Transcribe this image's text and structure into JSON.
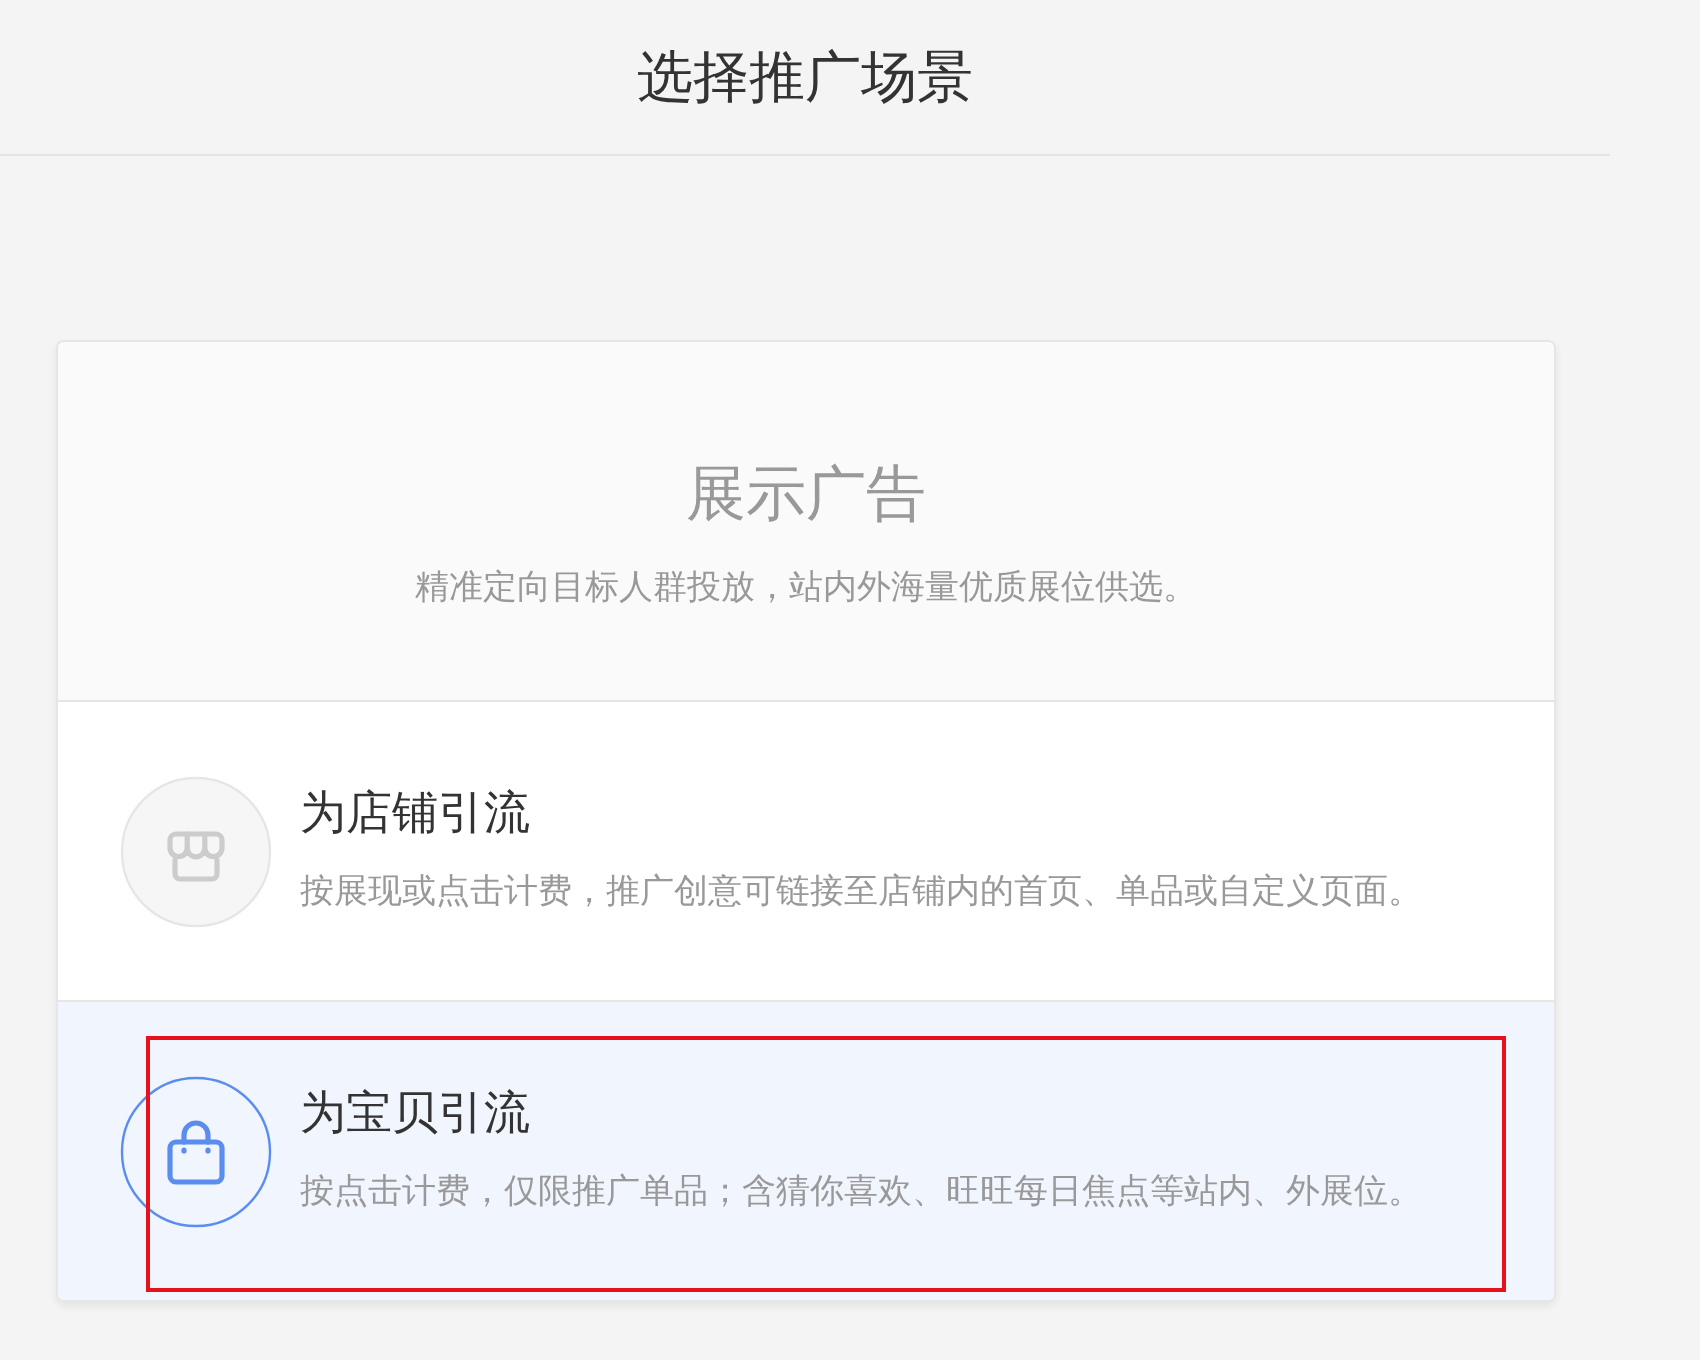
{
  "header": {
    "title": "选择推广场景"
  },
  "card": {
    "banner": {
      "title": "展示广告",
      "description": "精准定向目标人群投放，站内外海量优质展位供选。"
    },
    "options": [
      {
        "kind": "store",
        "title": "为店铺引流",
        "description": "按展现或点击计费，推广创意可链接至店铺内的首页、单品或自定义页面。",
        "selected": false,
        "highlighted": false
      },
      {
        "kind": "product",
        "title": "为宝贝引流",
        "description": "按点击计费，仅限推广单品；含猜你喜欢、旺旺每日焦点等站内、外展位。",
        "selected": true,
        "highlighted": true
      }
    ]
  }
}
